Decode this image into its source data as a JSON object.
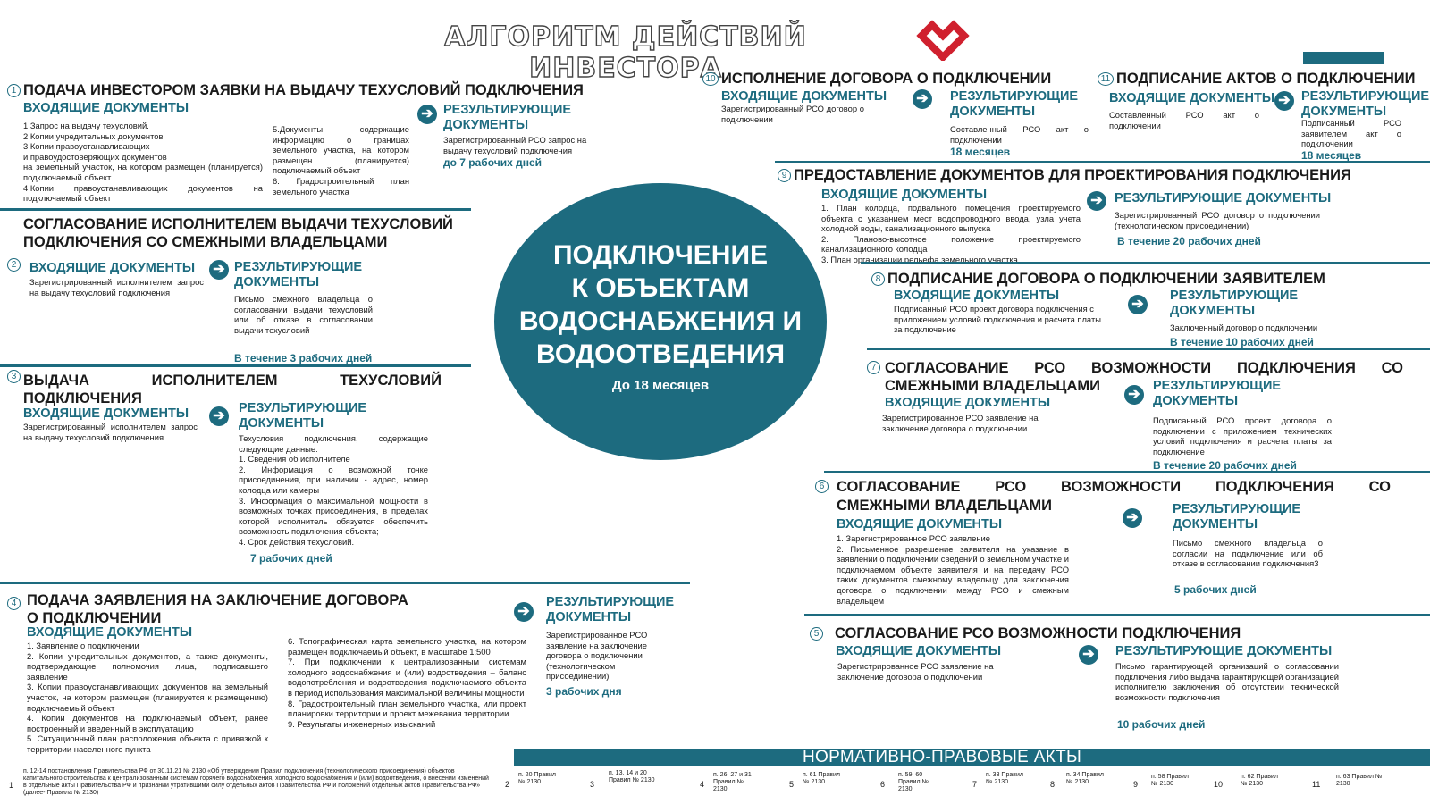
{
  "header": {
    "title": "АЛГОРИТМ ДЕЙСТВИЙ ИНВЕСТОРА",
    "brand_color": "#d0202e",
    "accent_color": "#1d6b7f"
  },
  "center": {
    "title_lines": [
      "ПОДКЛЮЧЕНИЕ",
      "К ОБЪЕКТАМ",
      "ВОДОСНАБЖЕНИЯ И",
      "ВОДООТВЕДЕНИЯ"
    ],
    "subtitle": "До 18 месяцев"
  },
  "labels": {
    "incoming": "ВХОДЯЩИЕ ДОКУМЕНТЫ",
    "resulting": "РЕЗУЛЬТИРУЮЩИЕ ДОКУМЕНТЫ",
    "resulting_l1": "РЕЗУЛЬТИРУЮЩИЕ",
    "resulting_l2": "ДОКУМЕНТЫ",
    "arrow_glyph": "➔"
  },
  "s1": {
    "num": "1",
    "title": "ПОДАЧА ИНВЕСТОРОМ ЗАЯВКИ НА ВЫДАЧУ ТЕХУСЛОВИЙ ПОДКЛЮЧЕНИЯ",
    "in_a": "1.Запрос на выдачу техусловий.\n2.Копии учредительных документов\n3.Копии правоустанавливающих\nи правоудостоверяющих документов\nна земельный участок, на котором размещен (планируется) подключаемый объект\n4.Копии правоустанавливающих документов на подключаемый объект",
    "in_b": "5.Документы, содержащие информацию о границах земельного участка, на котором размещен (планируется) подключаемый объект\n6. Градостроительный план земельного участка",
    "out": "Зарегистрированный РСО запрос на выдачу техусловий подключения",
    "deadline": "до 7 рабочих дней"
  },
  "s2": {
    "num": "2",
    "title_l1": "СОГЛАСОВАНИЕ ИСПОЛНИТЕЛЕМ ВЫДАЧИ ТЕХУСЛОВИЙ",
    "title_l2": "ПОДКЛЮЧЕНИЯ СО СМЕЖНЫМИ ВЛАДЕЛЬЦАМИ",
    "in": "Зарегистрированный исполнителем запрос на выдачу техусловий подключения",
    "out": "Письмо смежного владельца о согласовании выдачи техусловий или об отказе в согласовании выдачи техусловий",
    "deadline": "В течение 3 рабочих дней"
  },
  "s3": {
    "num": "3",
    "title_l1": "ВЫДАЧА ИСПОЛНИТЕЛЕМ ТЕХУСЛОВИЙ",
    "title_l2": "ПОДКЛЮЧЕНИЯ",
    "in": "Зарегистрированный исполнителем запрос на выдачу техусловий подключения",
    "out": "Техусловия подключения, содержащие следующие данные:\n1. Сведения об исполнителе\n2. Информация о возможной точке присоединения, при наличии - адрес, номер колодца или камеры\n3. Информация о максимальной мощности в возможных точках присоединения, в пределах которой исполнитель обязуется обеспечить возможность подключения объекта;\n4. Срок действия техусловий.",
    "deadline": "7 рабочих дней"
  },
  "s4": {
    "num": "4",
    "title_l1": "ПОДАЧА ЗАЯВЛЕНИЯ НА ЗАКЛЮЧЕНИЕ ДОГОВОРА",
    "title_l2": "О ПОДКЛЮЧЕНИИ",
    "in_a": "1. Заявление о подключении\n2. Копии учредительных документов, а также документы, подтверждающие полномочия лица, подписавшего заявление\n3. Копии правоустанавливающих документов на земельный участок, на котором размещен (планируется к размещению) подключаемый объект\n4. Копии документов на подключаемый объект, ранее построенный и введенный в эксплуатацию\n5. Ситуационный план расположения объекта с привязкой к территории населенного пункта",
    "in_b": "6. Топографическая карта земельного участка, на котором размещен подключаемый объект, в масштабе 1:500\n7. При подключении к централизованным системам холодного водоснабжения и (или) водоотведения – баланс водопотребления и водоотведения подключаемого объекта в период использования максимальной величины мощности\n8. Градостроительный план земельного участка, или проект планировки территории и проект межевания территории\n9. Результаты инженерных изысканий",
    "out": "Зарегистрированное РСО заявление на заключение договора о подключении (технологическом присоединении)",
    "deadline": "3 рабочих дня"
  },
  "s5": {
    "num": "5",
    "title": "СОГЛАСОВАНИЕ РСО ВОЗМОЖНОСТИ ПОДКЛЮЧЕНИЯ",
    "in": "Зарегистрированное РСО заявление на заключение договора о подключении",
    "out": "Письмо гарантирующей организаций о согласовании подключения либо выдача гарантирующей организацией исполнителю заключения об отсутствии технической возможности подключения",
    "deadline": "10 рабочих дней"
  },
  "s6": {
    "num": "6",
    "title_l1": "СОГЛАСОВАНИЕ РСО ВОЗМОЖНОСТИ ПОДКЛЮЧЕНИЯ СО",
    "title_l2": "СМЕЖНЫМИ ВЛАДЕЛЬЦАМИ",
    "in": "1. Зарегистрированное РСО заявление\n2. Письменное разрешение заявителя на указание в заявлении о подключении сведений о земельном участке и подключаемом объекте заявителя и на передачу РСО таких документов смежному владельцу для заключения договора о подключении между РСО и смежным владельцем",
    "out": "Письмо смежного владельца о согласии на подключение или об отказе в согласовании подключения3",
    "deadline": "5 рабочих дней"
  },
  "s7": {
    "num": "7",
    "title_l1": "СОГЛАСОВАНИЕ РСО ВОЗМОЖНОСТИ ПОДКЛЮЧЕНИЯ СО",
    "title_l2": "СМЕЖНЫМИ ВЛАДЕЛЬЦАМИ",
    "in": "Зарегистрированное РСО заявление на заключение договора о подключении",
    "out": "Подписанный РСО проект договора о подключении с приложением технических условий подключения и расчета платы за подключение",
    "deadline": "В течение 20 рабочих дней"
  },
  "s8": {
    "num": "8",
    "title": "ПОДПИСАНИЕ ДОГОВОРА О ПОДКЛЮЧЕНИИ ЗАЯВИТЕЛЕМ",
    "in": "Подписанный РСО проект договора подключения с приложением условий подключения и расчета платы за подключение",
    "out": "Заключенный договор о подключении",
    "deadline": "В течение 10 рабочих дней"
  },
  "s9": {
    "num": "9",
    "title": "ПРЕДОСТАВЛЕНИЕ ДОКУМЕНТОВ ДЛЯ ПРОЕКТИРОВАНИЯ ПОДКЛЮЧЕНИЯ",
    "in": "1. План колодца, подвального помещения проектируемого объекта с указанием мест водопроводного ввода, узла учета холодной воды, канализационного выпуска\n2. Планово-высотное положение проектируемого канализационного колодца\n3. План организации рельефа земельного участка",
    "out": "Зарегистрированный РСО договор о подключении (технологическом присоединении)",
    "deadline": "В течение 20 рабочих дней"
  },
  "s10": {
    "num": "10",
    "title": "ИСПОЛНЕНИЕ ДОГОВОРА О ПОДКЛЮЧЕНИИ",
    "in": "Зарегистрированный РСО договор о подключении",
    "out": "Составленный РСО акт о подключении",
    "deadline": "18 месяцев"
  },
  "s11": {
    "num": "11",
    "title": "ПОДПИСАНИЕ АКТОВ О ПОДКЛЮЧЕНИИ",
    "in": "Составленный РСО акт о подключении",
    "out": "Подписанный РСО заявителем акт о подключении",
    "deadline": "18 месяцев"
  },
  "normative": {
    "title": "НОРМАТИВНО-ПРАВОВЫЕ АКТЫ",
    "acts": [
      {
        "n": "1",
        "text": "п. 12-14 постановления Правительства РФ от 30.11.21 № 2130 «Об утверждении Правил подключения (технологического присоединения) объектов капитального строительства к централизованным системам горячего водоснабжения, холодного водоснабжения и (или) водоотведения, о внесении изменений в отдельные акты Правительства РФ и признании утратившими силу отдельных актов Правительства РФ и положений отдельных актов Правительства РФ» (далее- Правила № 2130)"
      },
      {
        "n": "2",
        "text": "п. 20 Правил № 2130"
      },
      {
        "n": "3",
        "text": "п. 13, 14 и 20 Правил № 2130"
      },
      {
        "n": "4",
        "text": "п. 26, 27 и 31 Правил № 2130"
      },
      {
        "n": "5",
        "text": "п. 61 Правил № 2130"
      },
      {
        "n": "6",
        "text": "п. 59, 60 Правил № 2130"
      },
      {
        "n": "7",
        "text": "п. 33 Правил № 2130"
      },
      {
        "n": "8",
        "text": "п. 34 Правил № 2130"
      },
      {
        "n": "9",
        "text": "п. 58 Правил № 2130"
      },
      {
        "n": "10",
        "text": "п. 62 Правил № 2130"
      },
      {
        "n": "11",
        "text": "п. 63 Правил № 2130"
      }
    ]
  }
}
